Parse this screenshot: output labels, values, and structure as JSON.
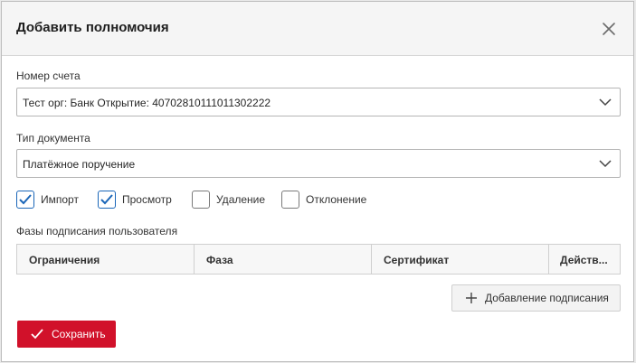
{
  "dialog": {
    "title": "Добавить полномочия"
  },
  "account": {
    "label": "Номер счета",
    "value": "Тест орг: Банк Открытие: 40702810111011302222"
  },
  "doc_type": {
    "label": "Тип документа",
    "value": "Платёжное поручение"
  },
  "permissions": [
    {
      "label": "Импорт",
      "checked": true
    },
    {
      "label": "Просмотр",
      "checked": true
    },
    {
      "label": "Удаление",
      "checked": false
    },
    {
      "label": "Отклонение",
      "checked": false
    }
  ],
  "signing": {
    "label": "Фазы подписания пользователя",
    "columns": [
      "Ограничения",
      "Фаза",
      "Сертификат",
      "Действ..."
    ]
  },
  "buttons": {
    "add_signing": "Добавление подписания",
    "save": "Сохранить"
  },
  "colors": {
    "accent": "#d1112a",
    "check": "#1a66b8"
  },
  "icons": {
    "close": "close-icon",
    "dropdown": "chevron-down-icon",
    "add": "plus-icon",
    "save": "check-icon"
  }
}
